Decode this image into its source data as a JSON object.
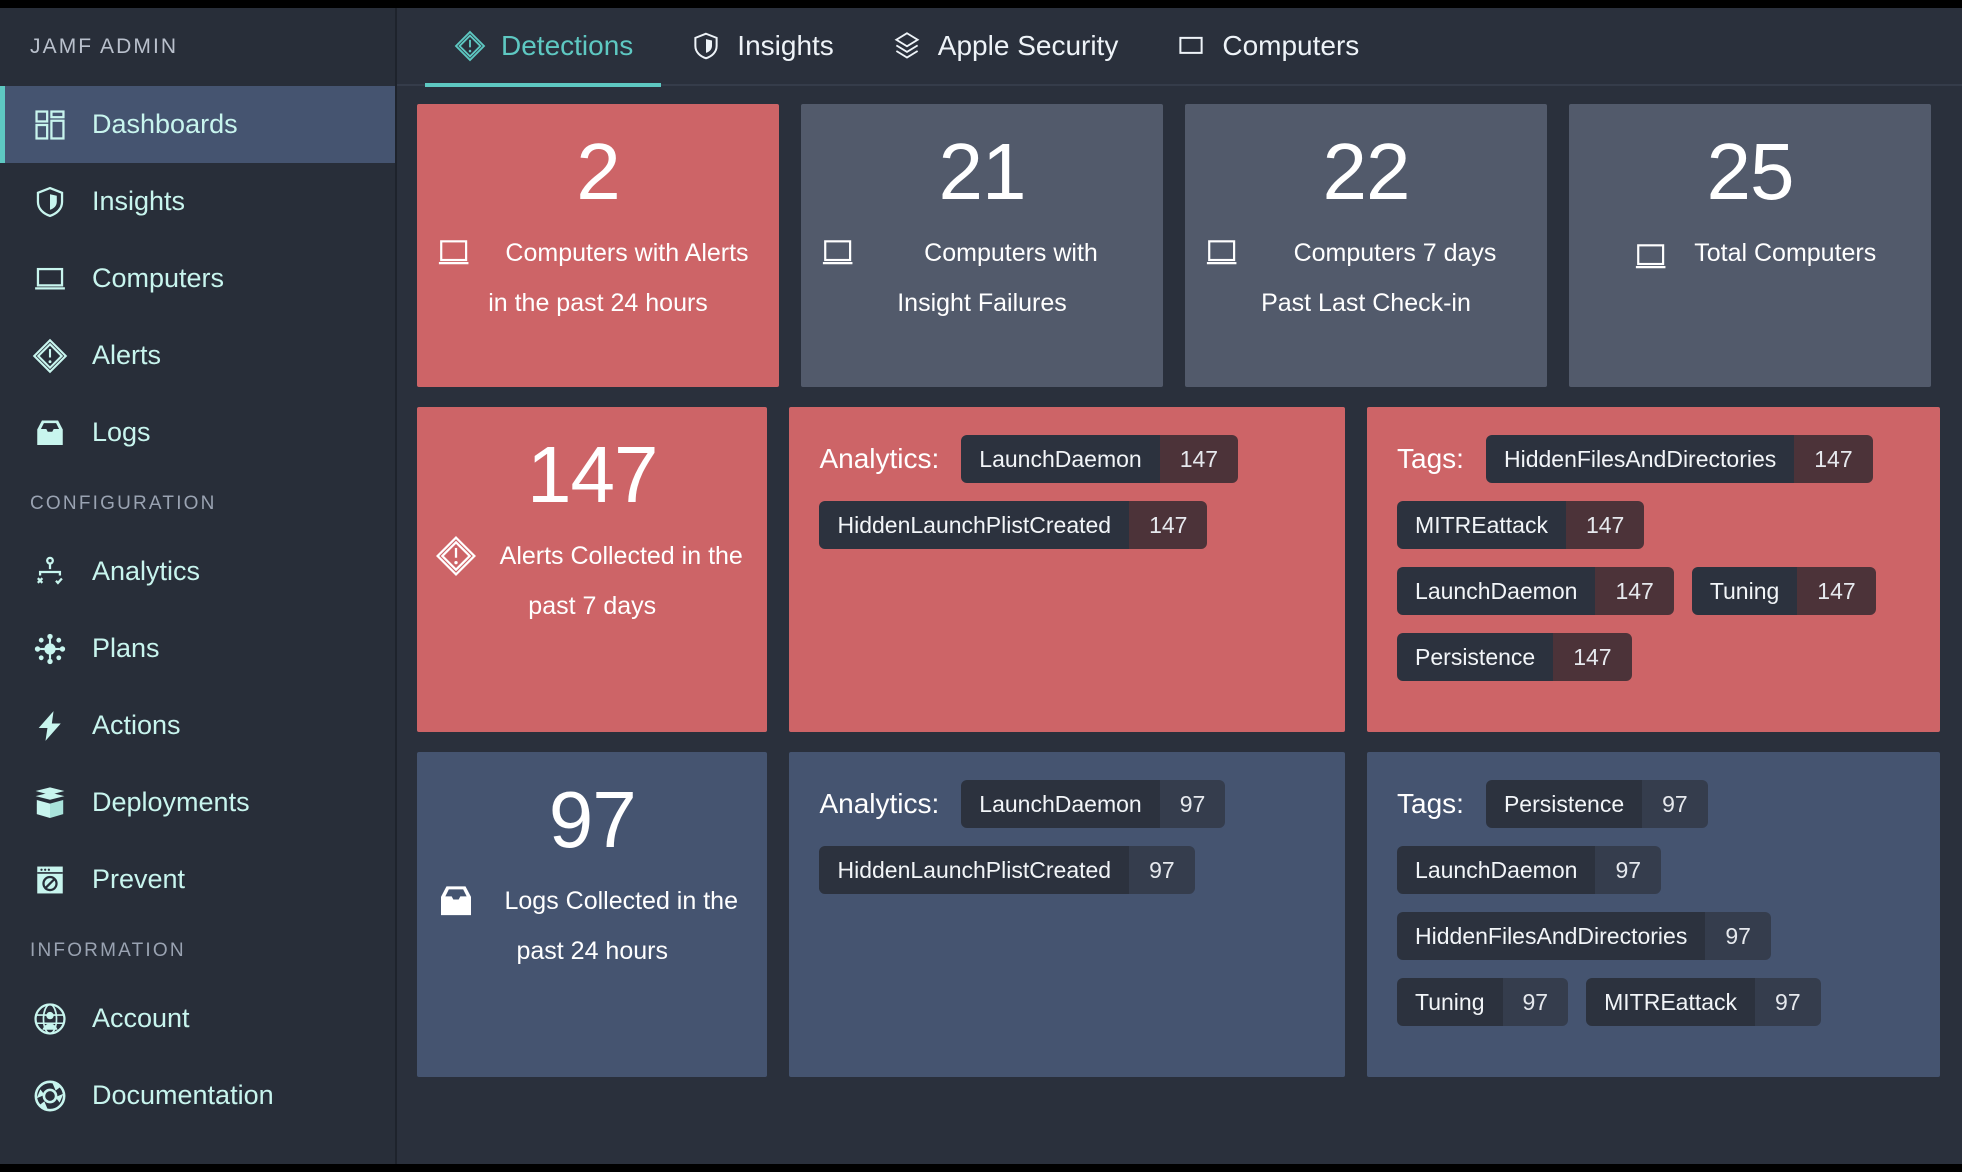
{
  "sidebar": {
    "brand": "JAMF ADMIN",
    "items": [
      {
        "label": "Dashboards",
        "icon": "dashboards-icon",
        "active": true
      },
      {
        "label": "Insights",
        "icon": "shield-icon",
        "active": false
      },
      {
        "label": "Computers",
        "icon": "laptop-icon",
        "active": false
      },
      {
        "label": "Alerts",
        "icon": "alert-diamond-icon",
        "active": false
      },
      {
        "label": "Logs",
        "icon": "logs-tray-icon",
        "active": false
      }
    ],
    "config_section": "CONFIGURATION",
    "config_items": [
      {
        "label": "Analytics",
        "icon": "analytics-node-icon"
      },
      {
        "label": "Plans",
        "icon": "plans-gear-icon"
      },
      {
        "label": "Actions",
        "icon": "bolt-icon"
      },
      {
        "label": "Deployments",
        "icon": "package-box-icon"
      },
      {
        "label": "Prevent",
        "icon": "prevent-block-icon"
      }
    ],
    "info_section": "INFORMATION",
    "info_items": [
      {
        "label": "Account",
        "icon": "account-globe-icon"
      },
      {
        "label": "Documentation",
        "icon": "documentation-ring-icon"
      }
    ]
  },
  "tabs": [
    {
      "label": "Detections",
      "icon": "alert-diamond-icon",
      "active": true
    },
    {
      "label": "Insights",
      "icon": "shield-icon",
      "active": false
    },
    {
      "label": "Apple Security",
      "icon": "layers-icon",
      "active": false
    },
    {
      "label": "Computers",
      "icon": "laptop-icon",
      "active": false
    }
  ],
  "colors": {
    "accent_teal": "#5ec8c2",
    "alert_red": "#cd6467",
    "card_slate": "#525a6b",
    "panel_blue": "#455470",
    "background": "#2a303c"
  },
  "stat_cards": [
    {
      "value": "2",
      "line1": "Computers with Alerts",
      "line2": "in the past 24 hours",
      "icon": "laptop-icon",
      "tone": "red"
    },
    {
      "value": "21",
      "line1": "Computers with",
      "line2": "Insight Failures",
      "icon": "laptop-icon",
      "tone": "blue"
    },
    {
      "value": "22",
      "line1": "Computers 7 days",
      "line2": "Past Last Check-in",
      "icon": "laptop-icon",
      "tone": "blue"
    },
    {
      "value": "25",
      "line1": "Total Computers",
      "line2": "",
      "icon": "laptop-icon",
      "tone": "blue"
    }
  ],
  "alerts_row": {
    "metric": {
      "value": "147",
      "line1": "Alerts Collected in the",
      "line2": "past 7 days",
      "icon": "alert-diamond-icon",
      "tone": "red"
    },
    "analytics_label": "Analytics:",
    "analytics_chips": [
      {
        "name": "LaunchDaemon",
        "count": "147"
      },
      {
        "name": "HiddenLaunchPlistCreated",
        "count": "147"
      }
    ],
    "tags_label": "Tags:",
    "tags_chips": [
      {
        "name": "HiddenFilesAndDirectories",
        "count": "147"
      },
      {
        "name": "MITREattack",
        "count": "147"
      },
      {
        "name": "LaunchDaemon",
        "count": "147"
      },
      {
        "name": "Tuning",
        "count": "147"
      },
      {
        "name": "Persistence",
        "count": "147"
      }
    ]
  },
  "logs_row": {
    "metric": {
      "value": "97",
      "line1": "Logs Collected in the",
      "line2": "past 24 hours",
      "icon": "logs-tray-icon",
      "tone": "blue"
    },
    "analytics_label": "Analytics:",
    "analytics_chips": [
      {
        "name": "LaunchDaemon",
        "count": "97"
      },
      {
        "name": "HiddenLaunchPlistCreated",
        "count": "97"
      }
    ],
    "tags_label": "Tags:",
    "tags_chips": [
      {
        "name": "Persistence",
        "count": "97"
      },
      {
        "name": "LaunchDaemon",
        "count": "97"
      },
      {
        "name": "HiddenFilesAndDirectories",
        "count": "97"
      },
      {
        "name": "Tuning",
        "count": "97"
      },
      {
        "name": "MITREattack",
        "count": "97"
      }
    ]
  }
}
